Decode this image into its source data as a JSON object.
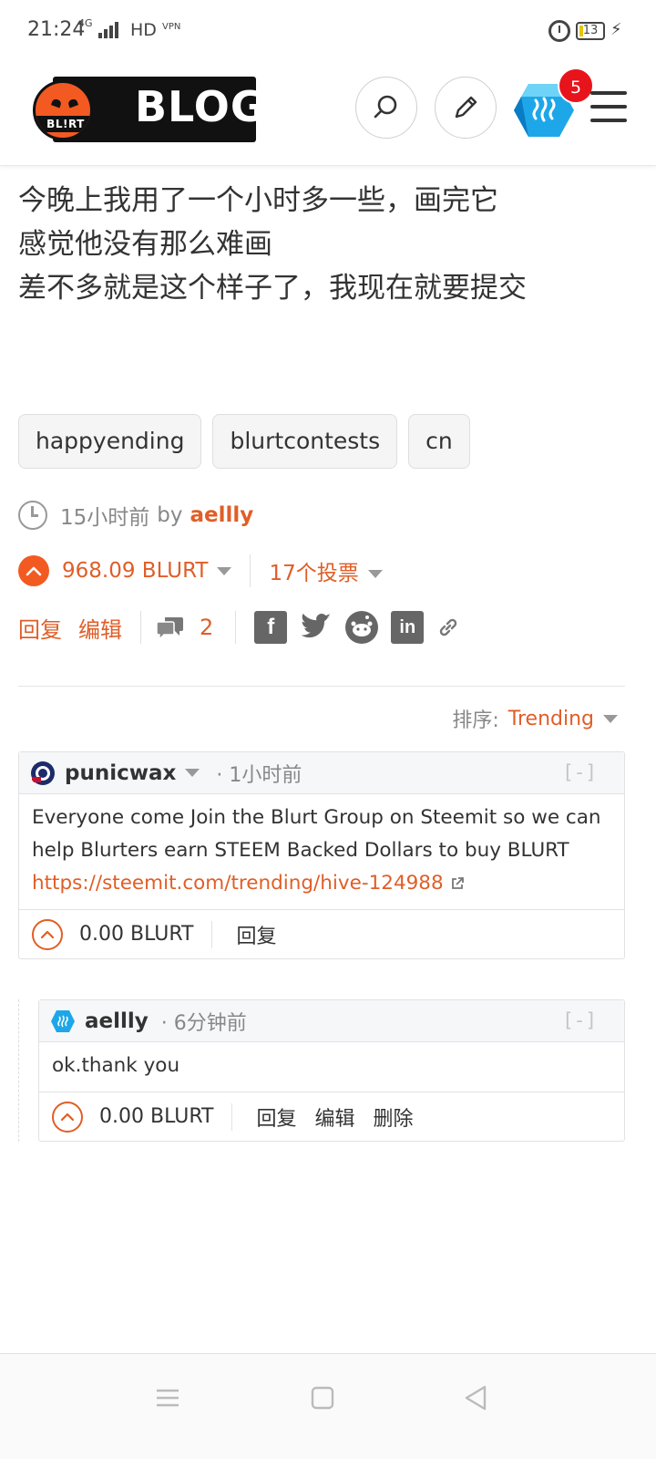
{
  "status_bar": {
    "time": "21:24",
    "network": "4G",
    "hd": "HD",
    "vpn": "VPN",
    "battery": "13"
  },
  "header": {
    "logo_badge": "BL!RT",
    "logo_text": "BLOG",
    "notification_count": "5"
  },
  "post": {
    "lines": [
      "今晚上我用了一个小时多一些，画完它",
      "感觉他没有那么难画",
      "差不多就是这个样子了，我现在就要提交"
    ],
    "tags": [
      "happyending",
      "blurtcontests",
      "cn"
    ],
    "time_ago": "15小时前",
    "by_label": "by",
    "author": "aellly",
    "payout": "968.09 BLURT",
    "votes": "17个投票",
    "reply_label": "回复",
    "edit_label": "编辑",
    "comment_count": "2"
  },
  "sort": {
    "label": "排序:",
    "value": "Trending"
  },
  "comments": [
    {
      "author": "punicwax",
      "time": "· 1小时前",
      "collapse": "[-]",
      "body": "Everyone come Join the Blurt Group on Steemit so we can help Blurters earn STEEM Backed Dollars to buy BLURT",
      "link": "https://steemit.com/trending/hive-124988",
      "payout": "0.00 BLURT",
      "reply_label": "回复"
    },
    {
      "author": "aellly",
      "time": "· 6分钟前",
      "collapse": "[-]",
      "body": "ok.thank you",
      "payout": "0.00 BLURT",
      "reply_label": "回复",
      "edit_label": "编辑",
      "delete_label": "删除"
    }
  ],
  "colors": {
    "accent": "#e05e27",
    "vote_fill": "#f25a22",
    "badge": "#e8141b"
  },
  "icons": {
    "share": [
      "facebook-icon",
      "twitter-icon",
      "reddit-icon",
      "linkedin-icon",
      "link-icon"
    ]
  }
}
